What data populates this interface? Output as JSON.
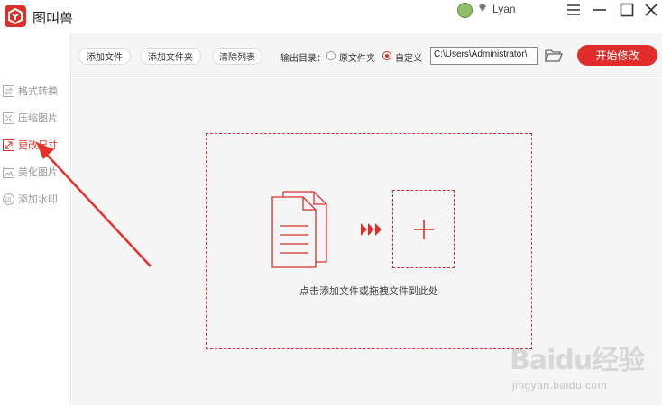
{
  "app": {
    "title": "图叫兽"
  },
  "user": {
    "name": "Lyan"
  },
  "sidebar": {
    "items": [
      {
        "label": "格式转换",
        "active": false
      },
      {
        "label": "压缩图片",
        "active": false
      },
      {
        "label": "更改尺寸",
        "active": true
      },
      {
        "label": "美化图片",
        "active": false
      },
      {
        "label": "添加水印",
        "active": false
      }
    ]
  },
  "toolbar": {
    "add_file": "添加文件",
    "add_folder": "添加文件夹",
    "clear_list": "清除列表",
    "output_label": "输出目录：",
    "option_original": "原文件夹",
    "option_custom": "自定义",
    "selected_option": "自定义",
    "output_path": "C:\\Users\\Administrator\\",
    "start": "开始修改"
  },
  "main": {
    "drop_hint": "点击添加文件或拖拽文件到此处"
  },
  "watermark": {
    "brand": "Baidu经验",
    "url": "jingyan.baidu.com"
  },
  "colors": {
    "accent": "#e02c2a",
    "annotation": "#e8302a",
    "panel_bg": "#f5f5f5"
  }
}
